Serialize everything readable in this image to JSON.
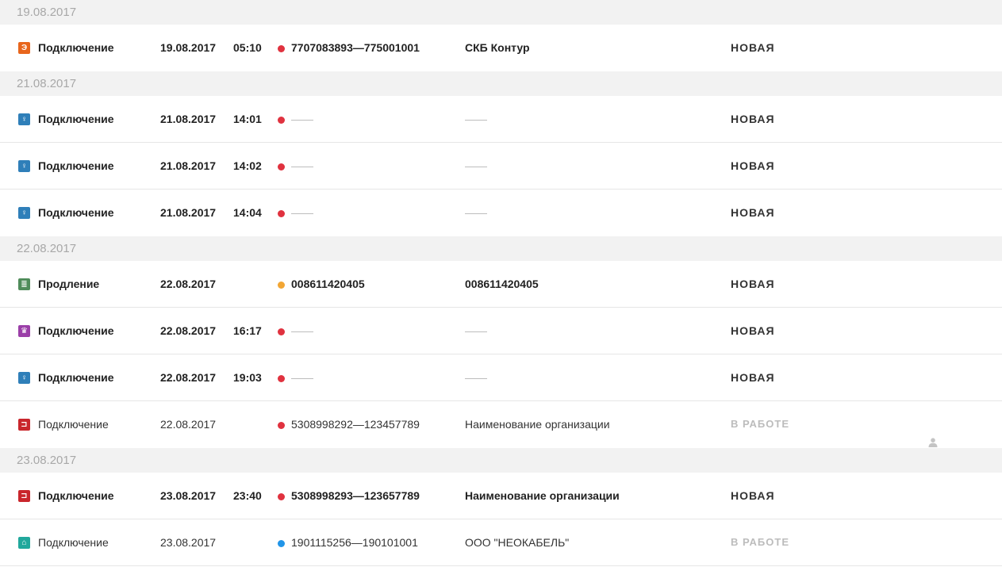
{
  "colors": {
    "icon_orange": "#e8661c",
    "icon_blue": "#2f7fb9",
    "icon_green": "#4f8c5a",
    "icon_purple": "#9b3fa8",
    "icon_red": "#c9262c",
    "icon_teal": "#21a89c",
    "dot_red": "#e0323f",
    "dot_orange": "#f2a634",
    "dot_blue": "#2195e8"
  },
  "groups": [
    {
      "date": "19.08.2017",
      "rows": [
        {
          "icon": "contour-e-icon",
          "icon_color": "#e8661c",
          "icon_glyph": "Э",
          "type": "Подключение",
          "date": "19.08.2017",
          "time": "05:10",
          "dot": "#e0323f",
          "inn": "7707083893—775001001",
          "org": "СКБ Контур",
          "status": "НОВАЯ",
          "bold": true,
          "user": false
        }
      ]
    },
    {
      "date": "21.08.2017",
      "rows": [
        {
          "icon": "lamp-icon",
          "icon_color": "#2f7fb9",
          "icon_glyph": "♀",
          "type": "Подключение",
          "date": "21.08.2017",
          "time": "14:01",
          "dot": "#e0323f",
          "inn": "",
          "org": "",
          "status": "НОВАЯ",
          "bold": true,
          "user": false
        },
        {
          "icon": "lamp-icon",
          "icon_color": "#2f7fb9",
          "icon_glyph": "♀",
          "type": "Подключение",
          "date": "21.08.2017",
          "time": "14:02",
          "dot": "#e0323f",
          "inn": "",
          "org": "",
          "status": "НОВАЯ",
          "bold": true,
          "user": false
        },
        {
          "icon": "lamp-icon",
          "icon_color": "#2f7fb9",
          "icon_glyph": "♀",
          "type": "Подключение",
          "date": "21.08.2017",
          "time": "14:04",
          "dot": "#e0323f",
          "inn": "",
          "org": "",
          "status": "НОВАЯ",
          "bold": true,
          "user": false
        }
      ]
    },
    {
      "date": "22.08.2017",
      "rows": [
        {
          "icon": "document-list-icon",
          "icon_color": "#4f8c5a",
          "icon_glyph": "≣",
          "type": "Продление",
          "date": "22.08.2017",
          "time": "",
          "dot": "#f2a634",
          "inn": "008611420405",
          "org": "008611420405",
          "status": "НОВАЯ",
          "bold": true,
          "user": false
        },
        {
          "icon": "crown-icon",
          "icon_color": "#9b3fa8",
          "icon_glyph": "♛",
          "type": "Подключение",
          "date": "22.08.2017",
          "time": "16:17",
          "dot": "#e0323f",
          "inn": "",
          "org": "",
          "status": "НОВАЯ",
          "bold": true,
          "user": false
        },
        {
          "icon": "lamp-icon",
          "icon_color": "#2f7fb9",
          "icon_glyph": "♀",
          "type": "Подключение",
          "date": "22.08.2017",
          "time": "19:03",
          "dot": "#e0323f",
          "inn": "",
          "org": "",
          "status": "НОВАЯ",
          "bold": true,
          "user": false
        },
        {
          "icon": "cart-icon",
          "icon_color": "#c9262c",
          "icon_glyph": "⊐",
          "type": "Подключение",
          "date": "22.08.2017",
          "time": "",
          "dot": "#e0323f",
          "inn": "5308998292—123457789",
          "org": "Наименование организации",
          "status": "В РАБОТЕ",
          "bold": false,
          "user": true
        }
      ]
    },
    {
      "date": "23.08.2017",
      "rows": [
        {
          "icon": "cart-icon",
          "icon_color": "#c9262c",
          "icon_glyph": "⊐",
          "type": "Подключение",
          "date": "23.08.2017",
          "time": "23:40",
          "dot": "#e0323f",
          "inn": "5308998293—123657789",
          "org": "Наименование организации",
          "status": "НОВАЯ",
          "bold": true,
          "user": false
        },
        {
          "icon": "building-icon",
          "icon_color": "#21a89c",
          "icon_glyph": "⌂",
          "type": "Подключение",
          "date": "23.08.2017",
          "time": "",
          "dot": "#2195e8",
          "inn": "1901115256—190101001",
          "org": "ООО \"НЕОКАБЕЛЬ\"",
          "status": "В РАБОТЕ",
          "bold": false,
          "user": false
        }
      ]
    }
  ]
}
